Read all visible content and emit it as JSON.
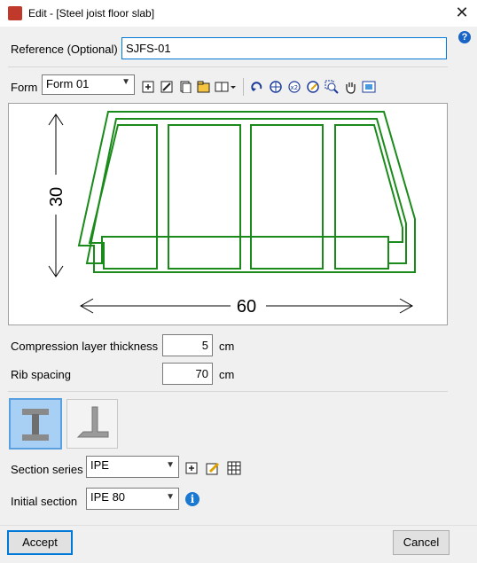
{
  "window": {
    "title": "Edit - [Steel joist floor slab]",
    "close_glyph": "✕",
    "help_glyph": "?"
  },
  "reference": {
    "label": "Reference (Optional)",
    "value": "SJFS-01"
  },
  "form": {
    "label": "Form",
    "selected": "Form 01",
    "tools": [
      "add-icon",
      "edit-icon",
      "copy-icon",
      "folder-icon",
      "library-icon",
      "undo-view-icon",
      "zoom-all-icon",
      "zoom-x2-icon",
      "refresh-icon",
      "zoom-window-icon",
      "pan-hand-icon",
      "export-view-icon"
    ]
  },
  "drawing": {
    "height_label": "30",
    "width_label": "60",
    "outline_color": "#1a8a1a"
  },
  "compression": {
    "label": "Compression layer thickness",
    "value": "5",
    "unit": "cm"
  },
  "rib": {
    "label": "Rib spacing",
    "value": "70",
    "unit": "cm"
  },
  "section_series": {
    "label": "Section series",
    "selected": "IPE"
  },
  "initial_section": {
    "label": "Initial section",
    "selected": "IPE 80"
  },
  "buttons": {
    "accept": "Accept",
    "cancel": "Cancel"
  }
}
